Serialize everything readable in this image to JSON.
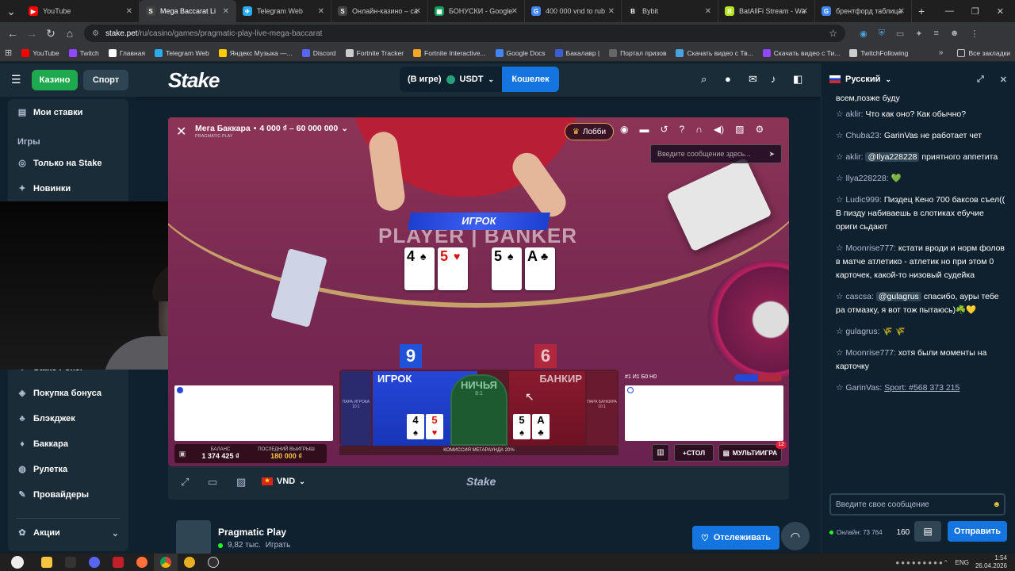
{
  "browser": {
    "tabs": [
      {
        "title": "YouTube",
        "color": "#ff0000",
        "glyph": "▶"
      },
      {
        "title": "Mega Baccarat Li",
        "color": "#444",
        "glyph": "S",
        "active": true
      },
      {
        "title": "Telegram Web",
        "color": "#2aabee",
        "glyph": "✈"
      },
      {
        "title": "Онлайн-казино – ca",
        "color": "#444",
        "glyph": "S"
      },
      {
        "title": "БОНУСКИ - Google",
        "color": "#0f9d58",
        "glyph": "▦"
      },
      {
        "title": "400 000 vnd to rub",
        "color": "#4285f4",
        "glyph": "G"
      },
      {
        "title": "Bybit",
        "color": "#222",
        "glyph": "B"
      },
      {
        "title": "BatAllFi Stream - Wa",
        "color": "#b5e61d",
        "glyph": "B"
      },
      {
        "title": "брентфорд таблица",
        "color": "#4285f4",
        "glyph": "G"
      }
    ],
    "url_host": "stake.pet",
    "url_path": "/ru/casino/games/pragmatic-play-live-mega-baccarat",
    "bookmarks": [
      {
        "label": "YouTube",
        "color": "#ff0000"
      },
      {
        "label": "Twitch",
        "color": "#9146ff"
      },
      {
        "label": "Главная",
        "color": "#fff"
      },
      {
        "label": "Telegram Web",
        "color": "#2aabee"
      },
      {
        "label": "Яндекс Музыка —...",
        "color": "#ffcc00"
      },
      {
        "label": "Discord",
        "color": "#5865f2"
      },
      {
        "label": "Fortnite Tracker",
        "color": "#ccc"
      },
      {
        "label": "Fortnite Interactive...",
        "color": "#f5a623"
      },
      {
        "label": "Google Docs",
        "color": "#4285f4"
      },
      {
        "label": "Бакалавр |",
        "color": "#3b5fd0"
      },
      {
        "label": "Портал призов",
        "color": "#666"
      },
      {
        "label": "Скачать видео с Тв...",
        "color": "#4aa3df"
      },
      {
        "label": "Скачать видео с Ти...",
        "color": "#9146ff"
      },
      {
        "label": "TwitchFollowing",
        "color": "#ccc"
      }
    ],
    "all_bookmarks": "Все закладки"
  },
  "header": {
    "casino": "Казино",
    "sport": "Спорт",
    "logo": "Stake",
    "in_game": "(В игре)",
    "currency": "USDT",
    "wallet": "Кошелек"
  },
  "sidebar": {
    "my_bets": "Мои ставки",
    "games_heading": "Игры",
    "items_top": [
      "Только на Stake",
      "Новинки"
    ],
    "items_bottom": [
      "Stake Poker",
      "Покупка бонуса",
      "Блэкджек",
      "Баккара",
      "Рулетка",
      "Провайдеры"
    ],
    "promotions": "Акции"
  },
  "game": {
    "title": "Мега Баккара",
    "limits": "4 000 ₫ – 60 000 000",
    "provider": "PRAGMATIC PLAY",
    "lobby": "Лобби",
    "chat_placeholder": "Введите сообщение здесь...",
    "banner": "ИГРОК",
    "table_text": "PLAYER | BANKER",
    "player_score": "9",
    "banker_score": "6",
    "player_label": "ИГРОК",
    "banker_label": "БАНКИР",
    "tie_label": "НИЧЬЯ",
    "tie_odds": "8:1",
    "pair_player": "ПАРА ИГРОКА",
    "pair_banker": "ПАРА БАНКИРА",
    "pair_odds": "10:1",
    "player_cards": [
      "4",
      "5"
    ],
    "banker_cards": [
      "5",
      "A"
    ],
    "balance_label": "БАЛАНС",
    "balance": "1 374 425 ₫",
    "last_win_label": "ПОСЛЕДНИЙ ВЫИГРЫШ",
    "last_win": "180 000 ₫",
    "commission": "КОМИССИЯ МЕГАРАУНДА 20%",
    "stats": "#1 И1 Б0 Н0",
    "add_table": "+СТОЛ",
    "multigame": "МУЛЬТИИГРА",
    "multigame_count": "12"
  },
  "gamebar": {
    "currency": "VND",
    "logo": "Stake"
  },
  "provider_row": {
    "name": "Pragmatic Play",
    "plays": "9,82 тыс.",
    "play_word": "Играть",
    "follow": "Отслеживать"
  },
  "chat": {
    "language": "Русский",
    "top_fragment": "всем,позже буду",
    "messages": [
      {
        "user": "aklir:",
        "text": "Что как оно? Как обычно?"
      },
      {
        "user": "Chuba23:",
        "text": "GarinVas не работает чет"
      },
      {
        "user": "aklir:",
        "tag": "@Ilya228228",
        "text": " приятного аппетита"
      },
      {
        "user": "Ilya228228:",
        "text": "💚"
      },
      {
        "user": "Ludic999:",
        "text": "Пиздец Кено 700 баксов съел(( В пизду набиваешь в слотиках ебучие ориги сьдают"
      },
      {
        "user": "Moonrise777:",
        "text": "кстати вроди и норм фолов в матче атлетико - атлетик но при этом 0 карточек, какой-то низовый судейка"
      },
      {
        "user": "cascsa:",
        "tag": "@gulagrus",
        "text": " спасибо, ауры тебе ра отмазку, я вот тож пытаюсь)☘️💛"
      },
      {
        "user": "gulagrus:",
        "text": "🌾 🌾"
      },
      {
        "user": "Moonrise777:",
        "text": "хотя были моменты на карточку"
      },
      {
        "user": "GarinVas:",
        "link": "Sport: #568 373 215"
      }
    ],
    "input_placeholder": "Введите свое сообщение",
    "online": "Онлайн: 73 764",
    "count": "160",
    "send": "Отправить"
  },
  "taskbar": {
    "lang": "ENG",
    "time": "1:54",
    "date": "26.04.2026"
  }
}
